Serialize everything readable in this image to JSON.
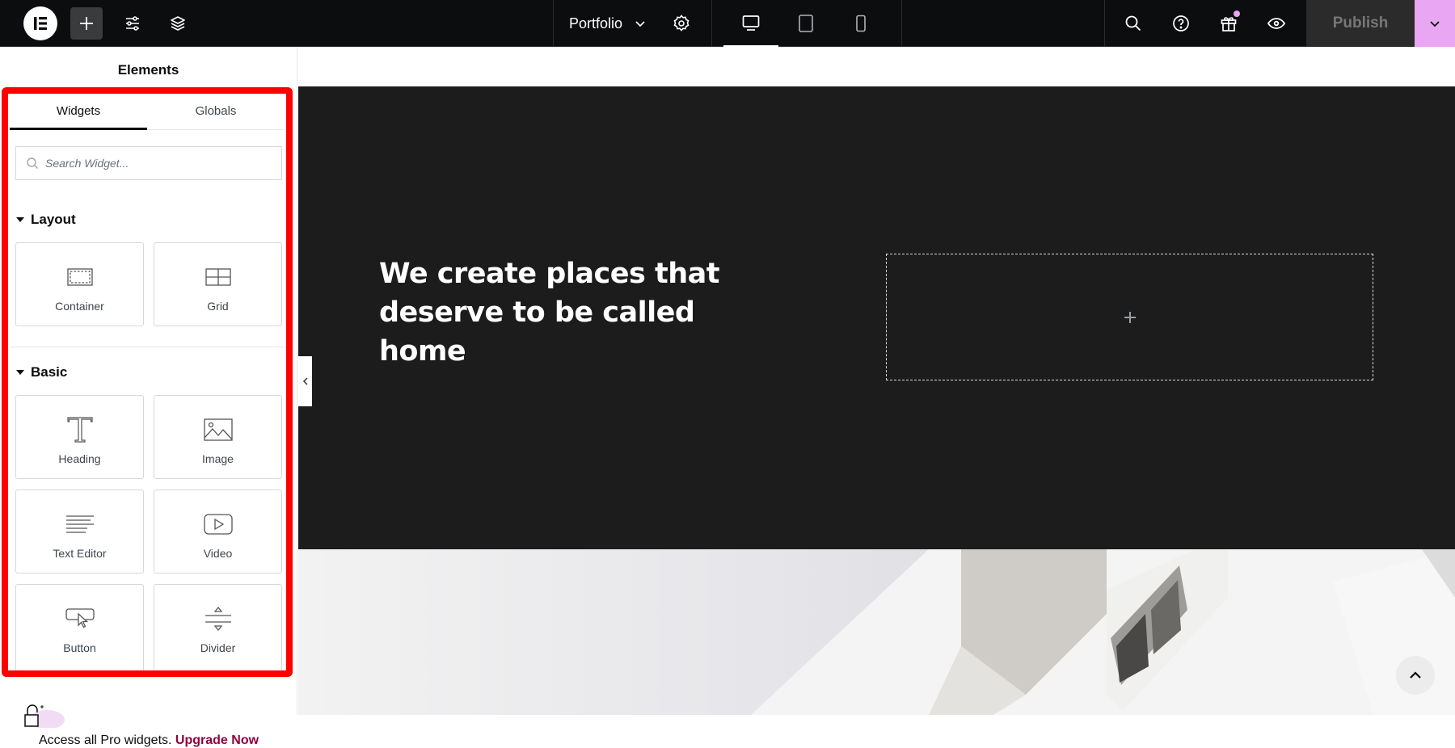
{
  "topbar": {
    "logo": "elementor-logo",
    "left_tools": [
      {
        "name": "add-element",
        "icon": "plus-icon",
        "active": true
      },
      {
        "name": "site-settings",
        "icon": "sliders-icon"
      },
      {
        "name": "structure",
        "icon": "layers-icon"
      }
    ],
    "document_title": "Portfolio",
    "document_icon_dropdown": "chevron-down-icon",
    "document_settings_icon": "gear-icon",
    "devices": [
      {
        "name": "desktop",
        "icon": "desktop-icon",
        "active": true
      },
      {
        "name": "tablet",
        "icon": "tablet-icon",
        "active": false
      },
      {
        "name": "mobile",
        "icon": "mobile-icon",
        "active": false
      }
    ],
    "right_tools": [
      {
        "name": "finder",
        "icon": "search-icon"
      },
      {
        "name": "help",
        "icon": "help-icon"
      },
      {
        "name": "whats-new",
        "icon": "gift-icon",
        "notification": true
      },
      {
        "name": "preview",
        "icon": "eye-icon"
      }
    ],
    "publish_label": "Publish",
    "publish_more_icon": "chevron-down-icon",
    "colors": {
      "bar": "#0c0d0e",
      "publish_bg": "#2b2b2b",
      "publish_more_bg": "#e9a6f2",
      "notification_dot": "#e9a6f2"
    }
  },
  "panel": {
    "title": "Elements",
    "tabs": [
      {
        "label": "Widgets",
        "active": true
      },
      {
        "label": "Globals",
        "active": false
      }
    ],
    "search_placeholder": "Search Widget...",
    "categories": [
      {
        "title": "Layout",
        "widgets": [
          {
            "label": "Container",
            "icon": "container-icon"
          },
          {
            "label": "Grid",
            "icon": "grid-icon"
          }
        ]
      },
      {
        "title": "Basic",
        "widgets": [
          {
            "label": "Heading",
            "icon": "heading-icon"
          },
          {
            "label": "Image",
            "icon": "image-icon"
          },
          {
            "label": "Text Editor",
            "icon": "text-editor-icon"
          },
          {
            "label": "Video",
            "icon": "video-icon"
          },
          {
            "label": "Button",
            "icon": "button-icon"
          },
          {
            "label": "Divider",
            "icon": "divider-icon"
          }
        ]
      }
    ],
    "promo_text": "Access all Pro widgets.",
    "promo_link": "Upgrade Now",
    "highlight_color": "#ff0000",
    "promo_link_color": "#93003f"
  },
  "canvas": {
    "hero_heading": "We create places that deserve to be called home",
    "hero_bg": "#1c1c1c",
    "drop_zone_icon": "plus-icon",
    "collapse_icon": "chevron-left-icon",
    "scroll_top_icon": "chevron-up-icon"
  }
}
